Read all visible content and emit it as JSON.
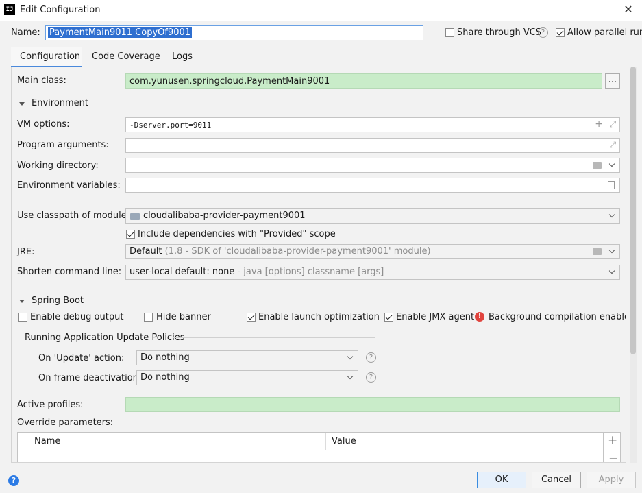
{
  "window": {
    "title": "Edit Configuration",
    "app_icon_text": "IJ"
  },
  "name_row": {
    "label": "Name:",
    "value": "PaymentMain9011 CopyOf9001",
    "share_vcs": "Share through VCS",
    "share_vcs_checked": false,
    "allow_parallel": "Allow parallel run",
    "allow_parallel_checked": true
  },
  "tabs": [
    {
      "label": "Configuration",
      "active": true
    },
    {
      "label": "Code Coverage",
      "active": false
    },
    {
      "label": "Logs",
      "active": false
    }
  ],
  "main_class": {
    "label": "Main class:",
    "value": "com.yunusen.springcloud.PaymentMain9001",
    "browse": "..."
  },
  "environment": {
    "section": "Environment",
    "vm_options": {
      "label": "VM options:",
      "value": "-Dserver.port=9011"
    },
    "program_arguments": {
      "label": "Program arguments:",
      "value": ""
    },
    "working_directory": {
      "label": "Working directory:",
      "value": ""
    },
    "environment_variables": {
      "label": "Environment variables:",
      "value": ""
    }
  },
  "classpath": {
    "label": "Use classpath of module:",
    "value": "cloudalibaba-provider-payment9001",
    "include_provided": "Include dependencies with \"Provided\" scope",
    "include_provided_checked": true
  },
  "jre": {
    "label": "JRE:",
    "value": "Default",
    "detail": "(1.8 - SDK of 'cloudalibaba-provider-payment9001' module)"
  },
  "shorten": {
    "label": "Shorten command line:",
    "value": "user-local default: none",
    "detail": "- java [options] classname [args]"
  },
  "spring_boot": {
    "section": "Spring Boot",
    "debug_output": {
      "label": "Enable debug output",
      "checked": false
    },
    "hide_banner": {
      "label": "Hide banner",
      "checked": false
    },
    "launch_optimization": {
      "label": "Enable launch optimization",
      "checked": true
    },
    "jmx_agent": {
      "label": "Enable JMX agent",
      "checked": true
    },
    "bg_compilation": "Background compilation enabled",
    "update_policies": "Running Application Update Policies",
    "on_update": {
      "label": "On 'Update' action:",
      "value": "Do nothing"
    },
    "on_frame": {
      "label": "On frame deactivation:",
      "value": "Do nothing"
    },
    "active_profiles": {
      "label": "Active profiles:",
      "value": ""
    },
    "override_params": {
      "label": "Override parameters:",
      "col_name": "Name",
      "col_value": "Value"
    }
  },
  "buttons": {
    "ok": "OK",
    "cancel": "Cancel",
    "apply": "Apply"
  },
  "colors": {
    "accent": "#4a89dc",
    "green_field": "#c9ecc9",
    "help": "#2c7be5",
    "warning": "#e0443e"
  }
}
